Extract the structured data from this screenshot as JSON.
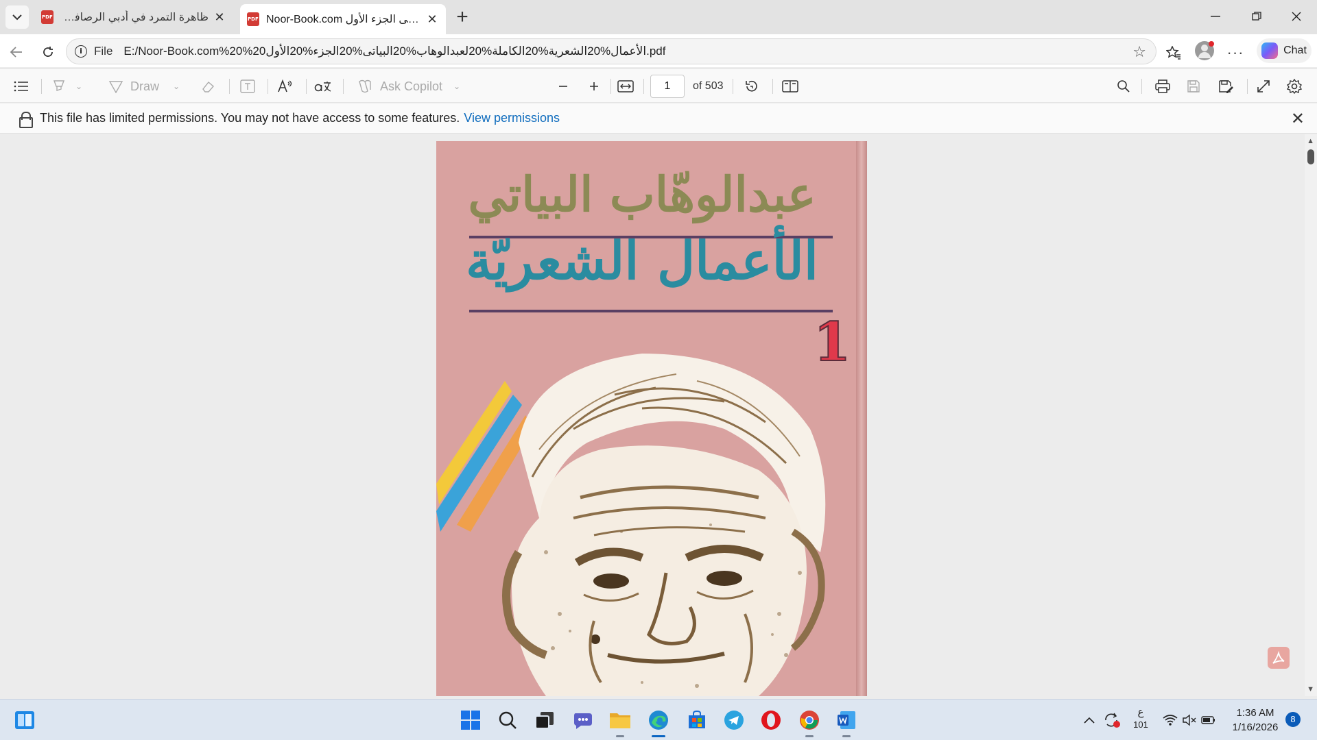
{
  "browser": {
    "tabs": [
      {
        "title": "ظاهرة التمرد في أدبي الرصافي والزهاوي",
        "active": false,
        "icon": "pdf-icon"
      },
      {
        "title": "Noor-Book.com البياتى الجزء الأول",
        "active": true,
        "icon": "pdf-icon"
      }
    ],
    "new_tab": "+",
    "address": {
      "scheme": "File",
      "url": "E:/Noor-Book.com%20%20الأعمال%20الشعرية%20الكاملة%20لعبدالوهاب%20البياتى%20الجزء%20الأول.pdf"
    },
    "chat_label": "Chat"
  },
  "pdf_toolbar": {
    "draw_label": "Draw",
    "ask_copilot_label": "Ask Copilot",
    "current_page": "1",
    "page_total_label": "of 503"
  },
  "banner": {
    "message": "This file has limited permissions. You may not have access to some features.",
    "link": "View permissions"
  },
  "cover": {
    "author": "عبدالوهّاب البياتي",
    "title": "الأعمال الشعريّة",
    "volume": "1"
  },
  "taskbar": {
    "apps": [
      "start-icon",
      "search-icon",
      "task-view-icon",
      "chat-icon",
      "file-explorer-icon",
      "edge-icon",
      "store-icon",
      "telegram-icon",
      "opera-icon",
      "chrome-icon",
      "word-icon"
    ],
    "keyboard_layout": "ع",
    "keyboard_sub": "101",
    "time": "1:36 AM",
    "date": "1/16/2026",
    "notifications": "8"
  },
  "colors": {
    "accent": "#0f6cbd",
    "cover_bg": "#d9a2a0",
    "author_color": "#8c8a55",
    "title_color": "#2a8ca0",
    "volume_color": "#e0394b"
  }
}
